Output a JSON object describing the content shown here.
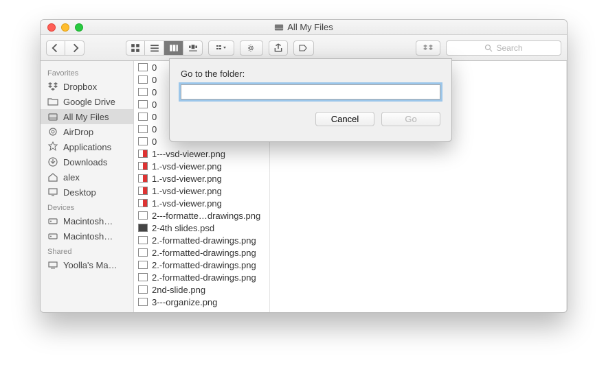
{
  "window": {
    "title": "All My Files"
  },
  "toolbar": {
    "search_placeholder": "Search"
  },
  "sidebar": {
    "sections": [
      {
        "header": "Favorites",
        "items": [
          {
            "label": "Dropbox"
          },
          {
            "label": "Google Drive"
          },
          {
            "label": "All My Files",
            "selected": true
          },
          {
            "label": "AirDrop"
          },
          {
            "label": "Applications"
          },
          {
            "label": "Downloads"
          },
          {
            "label": "alex"
          },
          {
            "label": "Desktop"
          }
        ]
      },
      {
        "header": "Devices",
        "items": [
          {
            "label": "Macintosh…"
          },
          {
            "label": "Macintosh…"
          }
        ]
      },
      {
        "header": "Shared",
        "items": [
          {
            "label": "Yoolla's Ma…"
          }
        ]
      }
    ]
  },
  "files": {
    "partial": [
      "0",
      "0",
      "0",
      "0",
      "0",
      "0",
      "0"
    ],
    "full": [
      "1---vsd-viewer.png",
      "1.-vsd-viewer.png",
      "1.-vsd-viewer.png",
      "1.-vsd-viewer.png",
      "1.-vsd-viewer.png",
      "2---formatte…drawings.png",
      "2-4th slides.psd",
      "2.-formatted-drawings.png",
      "2.-formatted-drawings.png",
      "2.-formatted-drawings.png",
      "2.-formatted-drawings.png",
      "2nd-slide.png",
      "3---organize.png"
    ]
  },
  "dialog": {
    "label": "Go to the folder:",
    "value": "",
    "cancel": "Cancel",
    "go": "Go"
  }
}
